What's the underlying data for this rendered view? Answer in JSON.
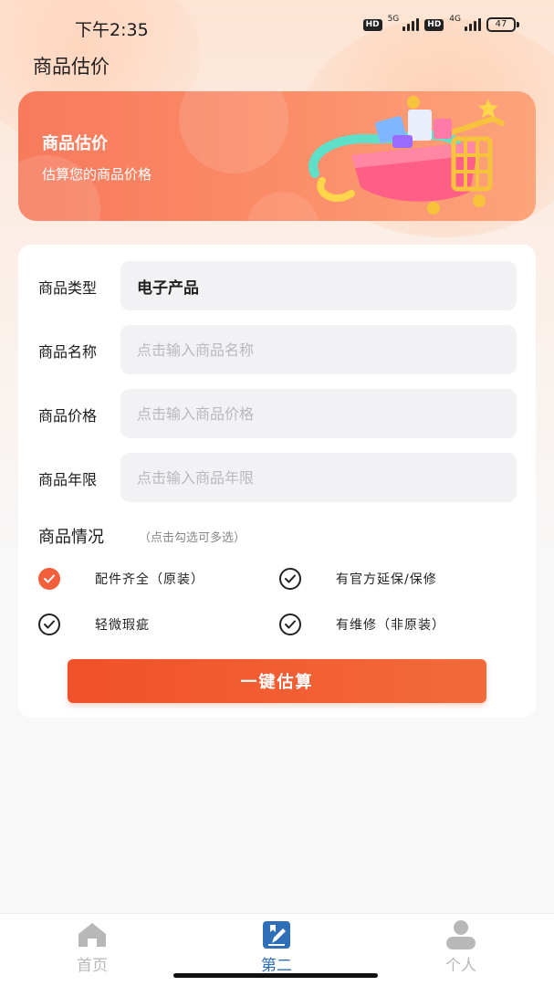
{
  "status_bar": {
    "time": "下午2:35",
    "sim1": {
      "badge": "HD",
      "network": "5G"
    },
    "sim2": {
      "badge": "HD",
      "network": "4G"
    },
    "battery": "47"
  },
  "page_title": "商品估价",
  "banner": {
    "title": "商品估价",
    "subtitle": "估算您的商品价格"
  },
  "form": {
    "fields": [
      {
        "label": "商品类型",
        "value": "电子产品",
        "placeholder": ""
      },
      {
        "label": "商品名称",
        "value": "",
        "placeholder": "点击输入商品名称"
      },
      {
        "label": "商品价格",
        "value": "",
        "placeholder": "点击输入商品价格"
      },
      {
        "label": "商品年限",
        "value": "",
        "placeholder": "点击输入商品年限"
      }
    ],
    "condition_title": "商品情况",
    "condition_hint": "（点击勾选可多选）",
    "options": [
      {
        "label": "配件齐全（原装）",
        "checked": true
      },
      {
        "label": "有官方延保/保修",
        "checked": false
      },
      {
        "label": "轻微瑕疵",
        "checked": false
      },
      {
        "label": "有维修（非原装）",
        "checked": false
      }
    ],
    "submit_label": "一键估算"
  },
  "tabs": [
    {
      "label": "首页",
      "icon": "home-icon",
      "active": false
    },
    {
      "label": "第二",
      "icon": "edit-note-icon",
      "active": true
    },
    {
      "label": "个人",
      "icon": "person-icon",
      "active": false
    }
  ],
  "colors": {
    "accent": "#f2603b",
    "tab_active": "#2f6fb7",
    "tab_inactive": "#b8b8b8"
  }
}
